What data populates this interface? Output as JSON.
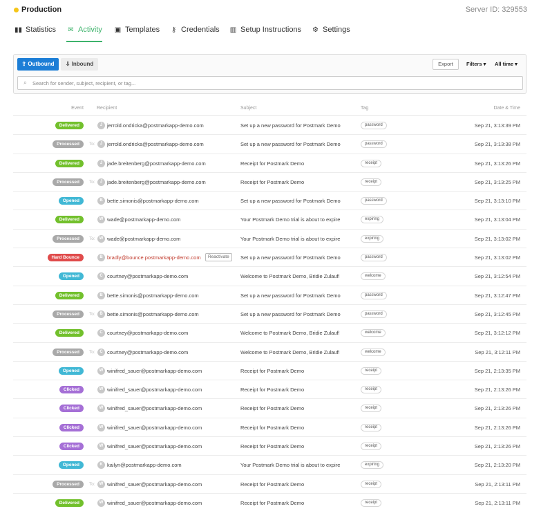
{
  "header": {
    "env_name": "Production",
    "server_id": "Server ID: 329553"
  },
  "tabs": [
    {
      "label": "Statistics",
      "icon": "chart-bar-icon",
      "glyph": "▮▮"
    },
    {
      "label": "Activity",
      "icon": "envelope-icon",
      "glyph": "✉"
    },
    {
      "label": "Templates",
      "icon": "template-icon",
      "glyph": "▣"
    },
    {
      "label": "Credentials",
      "icon": "key-icon",
      "glyph": "⚷"
    },
    {
      "label": "Setup Instructions",
      "icon": "map-icon",
      "glyph": "▥"
    },
    {
      "label": "Settings",
      "icon": "gear-icon",
      "glyph": "⚙"
    }
  ],
  "toolbar": {
    "outbound_label": "Outbound",
    "inbound_label": "Inbound",
    "export_label": "Export",
    "filters_label": "Filters ▾",
    "time_label": "All time ▾",
    "search_placeholder": "Search for sender, subject, recipient, or tag..."
  },
  "columns": {
    "event": "Event",
    "recipient": "Recipient",
    "subject": "Subject",
    "tag": "Tag",
    "datetime": "Date & Time"
  },
  "colors": {
    "accent": "#3db36b",
    "primary": "#1c7ed6",
    "delivered": "#72c02c",
    "processed": "#a9a9a9",
    "opened": "#41b8d5",
    "clicked": "#a56fd6",
    "bounce": "#e04b4b"
  },
  "rows": [
    {
      "event": "Delivered",
      "kind": "delivered",
      "to": "",
      "initial": "J",
      "recipient": "jerrold.ondricka@postmarkapp-demo.com",
      "subject": "Set up a new password for Postmark Demo",
      "tag": "password",
      "time": "Sep 21, 3:13:39 PM"
    },
    {
      "event": "Processed",
      "kind": "processed",
      "to": "To:",
      "initial": "J",
      "recipient": "jerrold.ondricka@postmarkapp-demo.com",
      "subject": "Set up a new password for Postmark Demo",
      "tag": "password",
      "time": "Sep 21, 3:13:38 PM"
    },
    {
      "event": "Delivered",
      "kind": "delivered",
      "to": "",
      "initial": "J",
      "recipient": "jade.breitenberg@postmarkapp-demo.com",
      "subject": "Receipt for Postmark Demo",
      "tag": "receipt",
      "time": "Sep 21, 3:13:26 PM"
    },
    {
      "event": "Processed",
      "kind": "processed",
      "to": "To:",
      "initial": "J",
      "recipient": "jade.breitenberg@postmarkapp-demo.com",
      "subject": "Receipt for Postmark Demo",
      "tag": "receipt",
      "time": "Sep 21, 3:13:25 PM"
    },
    {
      "event": "Opened",
      "kind": "opened",
      "to": "",
      "initial": "B",
      "recipient": "bette.simonis@postmarkapp-demo.com",
      "subject": "Set up a new password for Postmark Demo",
      "tag": "password",
      "time": "Sep 21, 3:13:10 PM"
    },
    {
      "event": "Delivered",
      "kind": "delivered",
      "to": "",
      "initial": "W",
      "recipient": "wade@postmarkapp-demo.com",
      "subject": "Your Postmark Demo trial is about to expire",
      "tag": "expiring",
      "time": "Sep 21, 3:13:04 PM"
    },
    {
      "event": "Processed",
      "kind": "processed",
      "to": "To:",
      "initial": "W",
      "recipient": "wade@postmarkapp-demo.com",
      "subject": "Your Postmark Demo trial is about to expire",
      "tag": "expiring",
      "time": "Sep 21, 3:13:02 PM"
    },
    {
      "event": "Hard Bounce",
      "kind": "bounce",
      "to": "",
      "initial": "B",
      "recipient": "bradly@bounce.postmarkapp-demo.com",
      "reactivate": "Reactivate",
      "subject": "Set up a new password for Postmark Demo",
      "tag": "password",
      "time": "Sep 21, 3:13:02 PM"
    },
    {
      "event": "Opened",
      "kind": "opened",
      "to": "",
      "initial": "C",
      "recipient": "courtney@postmarkapp-demo.com",
      "subject": "Welcome to Postmark Demo, Bridie Zulauf!",
      "tag": "welcome",
      "time": "Sep 21, 3:12:54 PM"
    },
    {
      "event": "Delivered",
      "kind": "delivered",
      "to": "",
      "initial": "B",
      "recipient": "bette.simonis@postmarkapp-demo.com",
      "subject": "Set up a new password for Postmark Demo",
      "tag": "password",
      "time": "Sep 21, 3:12:47 PM"
    },
    {
      "event": "Processed",
      "kind": "processed",
      "to": "To:",
      "initial": "B",
      "recipient": "bette.simonis@postmarkapp-demo.com",
      "subject": "Set up a new password for Postmark Demo",
      "tag": "password",
      "time": "Sep 21, 3:12:45 PM"
    },
    {
      "event": "Delivered",
      "kind": "delivered",
      "to": "",
      "initial": "C",
      "recipient": "courtney@postmarkapp-demo.com",
      "subject": "Welcome to Postmark Demo, Bridie Zulauf!",
      "tag": "welcome",
      "time": "Sep 21, 3:12:12 PM"
    },
    {
      "event": "Processed",
      "kind": "processed",
      "to": "To:",
      "initial": "C",
      "recipient": "courtney@postmarkapp-demo.com",
      "subject": "Welcome to Postmark Demo, Bridie Zulauf!",
      "tag": "welcome",
      "time": "Sep 21, 3:12:11 PM"
    },
    {
      "event": "Opened",
      "kind": "opened",
      "to": "",
      "initial": "W",
      "recipient": "winifred_sauer@postmarkapp-demo.com",
      "subject": "Receipt for Postmark Demo",
      "tag": "receipt",
      "time": "Sep 21, 2:13:35 PM"
    },
    {
      "event": "Clicked",
      "kind": "clicked",
      "to": "",
      "initial": "W",
      "recipient": "winifred_sauer@postmarkapp-demo.com",
      "subject": "Receipt for Postmark Demo",
      "tag": "receipt",
      "time": "Sep 21, 2:13:26 PM"
    },
    {
      "event": "Clicked",
      "kind": "clicked",
      "to": "",
      "initial": "W",
      "recipient": "winifred_sauer@postmarkapp-demo.com",
      "subject": "Receipt for Postmark Demo",
      "tag": "receipt",
      "time": "Sep 21, 2:13:26 PM"
    },
    {
      "event": "Clicked",
      "kind": "clicked",
      "to": "",
      "initial": "W",
      "recipient": "winifred_sauer@postmarkapp-demo.com",
      "subject": "Receipt for Postmark Demo",
      "tag": "receipt",
      "time": "Sep 21, 2:13:26 PM"
    },
    {
      "event": "Clicked",
      "kind": "clicked",
      "to": "",
      "initial": "W",
      "recipient": "winifred_sauer@postmarkapp-demo.com",
      "subject": "Receipt for Postmark Demo",
      "tag": "receipt",
      "time": "Sep 21, 2:13:26 PM"
    },
    {
      "event": "Opened",
      "kind": "opened",
      "to": "",
      "initial": "K",
      "recipient": "kailyn@postmarkapp-demo.com",
      "subject": "Your Postmark Demo trial is about to expire",
      "tag": "expiring",
      "time": "Sep 21, 2:13:20 PM"
    },
    {
      "event": "Processed",
      "kind": "processed",
      "to": "To:",
      "initial": "W",
      "recipient": "winifred_sauer@postmarkapp-demo.com",
      "subject": "Receipt for Postmark Demo",
      "tag": "receipt",
      "time": "Sep 21, 2:13:11 PM"
    },
    {
      "event": "Delivered",
      "kind": "delivered",
      "to": "",
      "initial": "W",
      "recipient": "winifred_sauer@postmarkapp-demo.com",
      "subject": "Receipt for Postmark Demo",
      "tag": "receipt",
      "time": "Sep 21, 2:13:11 PM"
    }
  ]
}
